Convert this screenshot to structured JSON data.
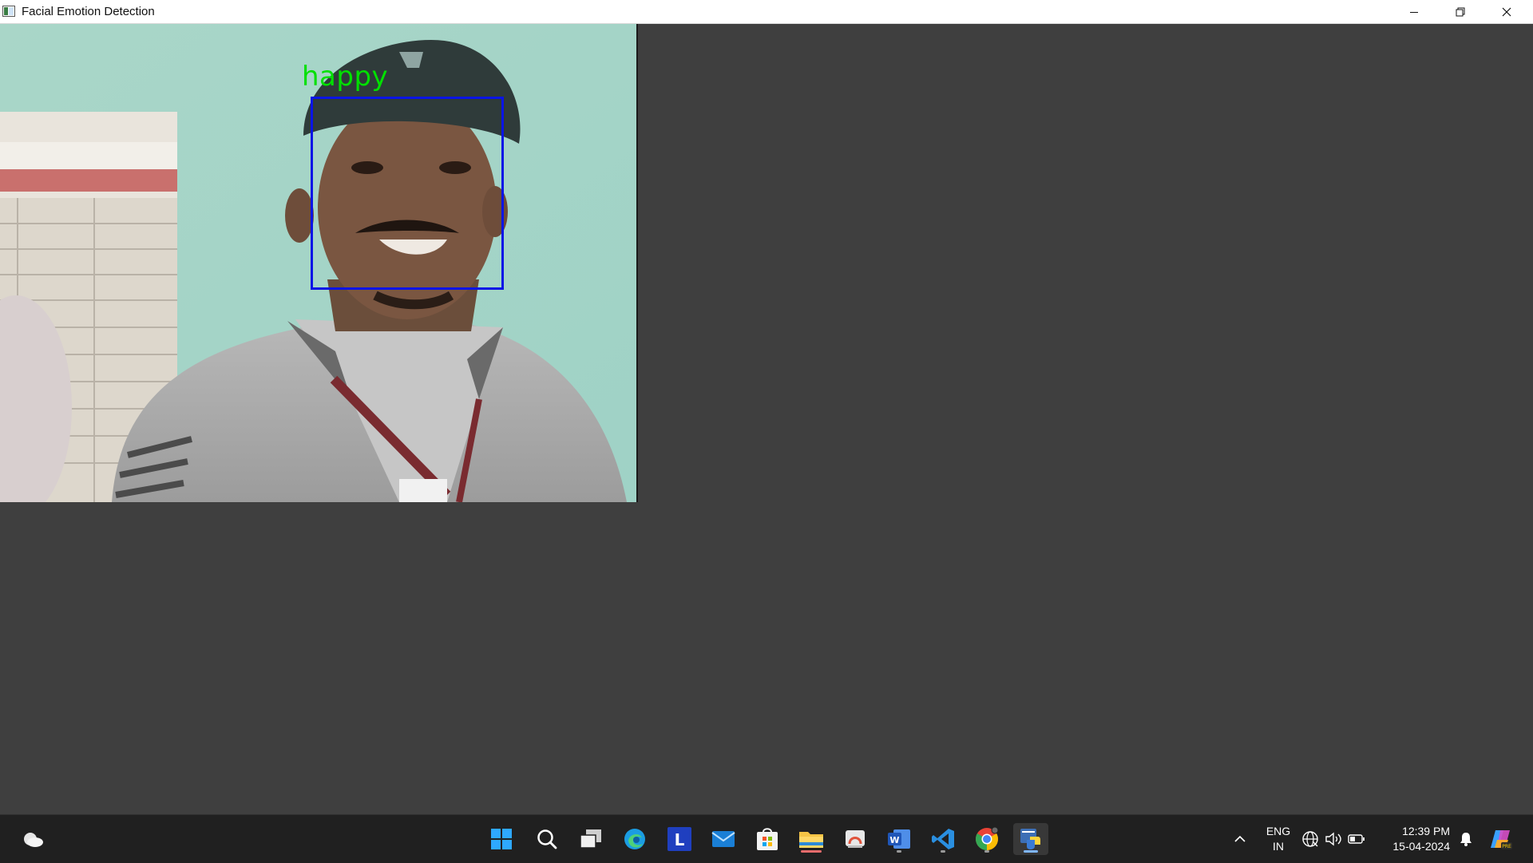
{
  "window": {
    "title": "Facial Emotion Detection",
    "controls": [
      "minimize",
      "restore",
      "close"
    ]
  },
  "video": {
    "detected_emotion": "happy",
    "label_color": "#00e000",
    "box_color": "#0a14e6"
  },
  "taskbar": {
    "left": [
      {
        "icon": "weather-icon"
      }
    ],
    "apps": [
      {
        "icon": "windows-start-icon"
      },
      {
        "icon": "search-icon"
      },
      {
        "icon": "task-view-icon"
      },
      {
        "icon": "edge-icon"
      },
      {
        "icon": "l-app-icon",
        "glyph": "L"
      },
      {
        "icon": "mail-icon"
      },
      {
        "icon": "store-icon"
      },
      {
        "icon": "file-explorer-icon"
      },
      {
        "icon": "remote-desktop-icon"
      },
      {
        "icon": "word-icon",
        "glyph": "W"
      },
      {
        "icon": "vscode-icon"
      },
      {
        "icon": "chrome-icon"
      },
      {
        "icon": "python-icon"
      }
    ],
    "tray": {
      "language_line1": "ENG",
      "language_line2": "IN",
      "time": "12:39 PM",
      "date": "15-04-2024"
    }
  }
}
